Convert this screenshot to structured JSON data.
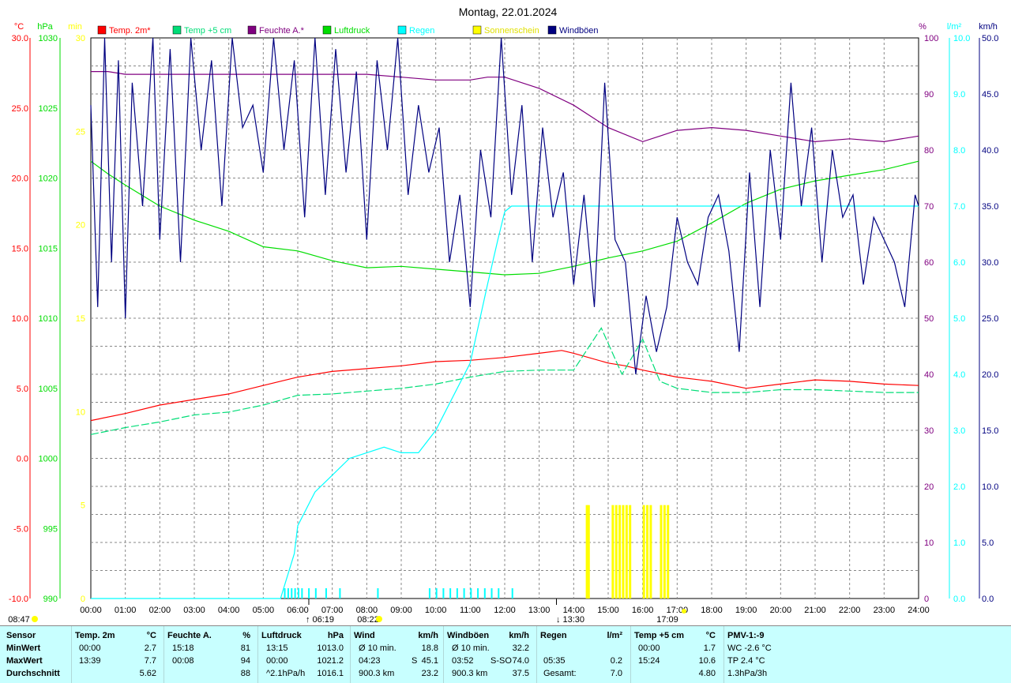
{
  "title": "Montag, 22.01.2024",
  "colors": {
    "temp2m": "#ff0000",
    "temp5cm": "#00dd77",
    "feuchte": "#800080",
    "luftdruck": "#00dd00",
    "regen": "#00ffff",
    "sonne": "#ffff00",
    "wind": "#000080",
    "grid": "#888888",
    "stats_bg": "#c8ffff"
  },
  "axis_units": {
    "temp": "°C",
    "hpa": "hPa",
    "min": "min",
    "pct": "%",
    "rain": "l/m²",
    "wind": "km/h"
  },
  "legend": [
    {
      "label": "Temp. 2m*",
      "color": "#ff0000"
    },
    {
      "label": "Temp +5 cm",
      "color": "#00dd77"
    },
    {
      "label": "Feuchte A.*",
      "color": "#800080"
    },
    {
      "label": "Luftdruck",
      "color": "#00dd00"
    },
    {
      "label": "Regen",
      "color": "#00ffff"
    },
    {
      "label": "Sonnenschein",
      "color": "#ffff00"
    },
    {
      "label": "Windböen",
      "color": "#000080"
    }
  ],
  "ticks": {
    "temp": [
      "30.0",
      "25.0",
      "20.0",
      "15.0",
      "10.0",
      "5.0",
      "0.0",
      "-5.0",
      "-10.0"
    ],
    "hpa": [
      "1030",
      "1025",
      "1020",
      "1015",
      "1010",
      "1005",
      "1000",
      "995",
      "990"
    ],
    "min": [
      "30",
      "25",
      "20",
      "15",
      "10",
      "5",
      "0"
    ],
    "pct": [
      "100",
      "90",
      "80",
      "70",
      "60",
      "50",
      "40",
      "30",
      "20",
      "10",
      "0"
    ],
    "rain": [
      "10.0",
      "9.0",
      "8.0",
      "7.0",
      "6.0",
      "5.0",
      "4.0",
      "3.0",
      "2.0",
      "1.0",
      "0.0"
    ],
    "wind": [
      "50.0",
      "45.0",
      "40.0",
      "35.0",
      "30.0",
      "25.0",
      "20.0",
      "15.0",
      "10.0",
      "5.0",
      "0.0"
    ],
    "hours": [
      "00:00",
      "01:00",
      "02:00",
      "03:00",
      "04:00",
      "05:00",
      "06:00",
      "07:00",
      "08:00",
      "09:00",
      "10:00",
      "11:00",
      "12:00",
      "13:00",
      "14:00",
      "15:00",
      "16:00",
      "17:00",
      "18:00",
      "19:00",
      "20:00",
      "21:00",
      "22:00",
      "23:00",
      "24:00"
    ]
  },
  "markers": [
    {
      "time": "08:47",
      "label": "08:47"
    },
    {
      "time": "06:19",
      "label": "↑ 06:19"
    },
    {
      "time": "08:22",
      "label": "08:22"
    },
    {
      "time": "13:30",
      "label": "↓ 13:30"
    },
    {
      "time": "17:09",
      "label": "17:09"
    }
  ],
  "chart_data": {
    "type": "line",
    "title": "Montag, 22.01.2024",
    "x_range": [
      "00:00",
      "24:00"
    ],
    "ylim_temp": [
      -10,
      30
    ],
    "ylim_hpa": [
      990,
      1030
    ],
    "ylim_min": [
      0,
      30
    ],
    "ylim_pct": [
      0,
      100
    ],
    "ylim_rain": [
      0,
      10
    ],
    "ylim_wind": [
      0,
      50
    ],
    "series": [
      {
        "name": "Temp. 2m*",
        "axis": "temp",
        "hours": [
          0,
          1,
          2,
          3,
          4,
          5,
          6,
          7,
          8,
          9,
          10,
          11,
          12,
          13,
          13.65,
          14,
          15,
          15.5,
          16,
          17,
          18,
          19,
          20,
          21,
          22,
          23,
          24
        ],
        "values": [
          2.7,
          3.2,
          3.8,
          4.2,
          4.6,
          5.2,
          5.8,
          6.2,
          6.4,
          6.6,
          6.9,
          7.0,
          7.2,
          7.5,
          7.7,
          7.5,
          6.8,
          6.6,
          6.3,
          5.8,
          5.5,
          5.0,
          5.3,
          5.6,
          5.5,
          5.3,
          5.2
        ]
      },
      {
        "name": "Temp +5 cm",
        "axis": "temp",
        "hours": [
          0,
          1,
          2,
          3,
          4,
          5,
          6,
          7,
          8,
          9,
          10,
          11,
          12,
          13,
          14,
          14.8,
          15.4,
          16,
          16.5,
          17,
          18,
          19,
          20,
          21,
          22,
          23,
          24
        ],
        "values": [
          1.7,
          2.2,
          2.6,
          3.1,
          3.3,
          3.8,
          4.5,
          4.6,
          4.8,
          5.0,
          5.3,
          5.8,
          6.2,
          6.3,
          6.3,
          9.3,
          6.0,
          8.5,
          5.5,
          5.0,
          4.7,
          4.7,
          4.9,
          4.9,
          4.8,
          4.7,
          4.7
        ]
      },
      {
        "name": "Feuchte A.*",
        "axis": "pct",
        "hours": [
          0,
          0.5,
          1,
          2,
          3,
          4,
          5,
          6,
          7,
          8,
          9,
          10,
          11,
          11.5,
          12,
          13,
          14,
          15,
          16,
          16.5,
          17,
          18,
          19,
          20,
          21,
          22,
          23,
          24
        ],
        "values": [
          94,
          94,
          93.5,
          93.5,
          93.5,
          93.5,
          93.5,
          93.5,
          93.5,
          93.5,
          93,
          92.5,
          92.5,
          93,
          93,
          91,
          88,
          84,
          81.5,
          82.5,
          83.5,
          84,
          83.5,
          82.5,
          81.5,
          82,
          81.5,
          82.5
        ]
      },
      {
        "name": "Luftdruck",
        "axis": "hpa",
        "hours": [
          0,
          0.5,
          1,
          2,
          3,
          4,
          5,
          6,
          7,
          8,
          9,
          10,
          11,
          12,
          13,
          14,
          15,
          16,
          17,
          18,
          19,
          20,
          21,
          22,
          23,
          24
        ],
        "values": [
          1021.2,
          1020.3,
          1019.5,
          1018,
          1017,
          1016.2,
          1015.1,
          1014.8,
          1014.1,
          1013.6,
          1013.7,
          1013.5,
          1013.3,
          1013.1,
          1013.2,
          1013.7,
          1014.3,
          1014.8,
          1015.5,
          1016.8,
          1018.2,
          1019.2,
          1019.8,
          1020.2,
          1020.6,
          1021.2
        ]
      },
      {
        "name": "Regen",
        "axis": "rain",
        "hours": [
          0,
          5.5,
          5.6,
          5.9,
          6,
          6.5,
          7,
          7.5,
          8,
          8.5,
          9,
          9.5,
          10,
          10.5,
          11,
          11.5,
          11.8,
          12,
          12.2,
          12.7,
          13,
          13.5,
          14,
          14.5,
          15,
          16,
          17,
          18,
          19,
          20,
          21,
          22,
          23,
          24
        ],
        "values": [
          0,
          0,
          0.2,
          0.8,
          1.3,
          1.9,
          2.2,
          2.5,
          2.6,
          2.7,
          2.6,
          2.6,
          3.0,
          3.6,
          4.2,
          5.6,
          6.4,
          6.9,
          7.0,
          7.0,
          7.0,
          7.0,
          7.0,
          7.0,
          7.0,
          7.0,
          7.0,
          7.0,
          7.0,
          7.0,
          7.0,
          7.0,
          7.0,
          7.0
        ]
      },
      {
        "name": "Windböen",
        "axis": "wind",
        "hours": [
          0,
          0.2,
          0.4,
          0.6,
          0.8,
          1,
          1.2,
          1.5,
          1.8,
          2,
          2.3,
          2.6,
          2.9,
          3.2,
          3.5,
          3.8,
          4.1,
          4.4,
          4.7,
          5,
          5.3,
          5.6,
          5.9,
          6.2,
          6.5,
          6.8,
          7.1,
          7.4,
          7.7,
          8,
          8.3,
          8.6,
          8.9,
          9.2,
          9.5,
          9.8,
          10.1,
          10.4,
          10.7,
          11,
          11.3,
          11.6,
          11.9,
          12.2,
          12.5,
          12.8,
          13.1,
          13.4,
          13.7,
          14,
          14.3,
          14.6,
          14.9,
          15.2,
          15.5,
          15.8,
          16.1,
          16.4,
          16.7,
          17,
          17.3,
          17.6,
          17.9,
          18.2,
          18.5,
          18.8,
          19.1,
          19.4,
          19.7,
          20,
          20.3,
          20.6,
          20.9,
          21.2,
          21.5,
          21.8,
          22.1,
          22.4,
          22.7,
          23,
          23.3,
          23.6,
          23.9,
          24
        ],
        "values": [
          44,
          26,
          50,
          30,
          48,
          25,
          46,
          35,
          50,
          32,
          49,
          30,
          50,
          40,
          48,
          35,
          50,
          42,
          44,
          38,
          50,
          40,
          48,
          34,
          50,
          36,
          49,
          38,
          47,
          32,
          48,
          40,
          50,
          36,
          44,
          38,
          42,
          30,
          36,
          26,
          40,
          34,
          50,
          36,
          44,
          30,
          42,
          34,
          38,
          28,
          36,
          26,
          46,
          32,
          30,
          20,
          27,
          22,
          26,
          34,
          30,
          28,
          34,
          36,
          31,
          22,
          38,
          26,
          40,
          32,
          46,
          35,
          42,
          30,
          40,
          34,
          36,
          28,
          34,
          32,
          30,
          26,
          36,
          35
        ]
      }
    ],
    "sun_minutes": {
      "hours": [
        14.35,
        14.4,
        15.1,
        15.2,
        15.3,
        15.4,
        15.5,
        15.6,
        16.0,
        16.1,
        16.2,
        16.5,
        16.6,
        16.7
      ],
      "values": [
        2,
        2,
        2,
        2,
        2,
        2,
        2,
        2,
        2,
        2,
        2,
        2,
        2,
        2
      ]
    },
    "rain_blips_hours": [
      5.6,
      5.7,
      5.8,
      5.9,
      6.0,
      6.1,
      6.3,
      6.5,
      6.8,
      7.2,
      8.3,
      9.8,
      10.0,
      10.2,
      10.4,
      10.6,
      10.8,
      11.0,
      11.2,
      11.4,
      11.6,
      11.8,
      12.2
    ]
  },
  "stats": {
    "headers": [
      "Sensor",
      "Temp. 2m",
      "°C",
      "Feuchte A.",
      "%",
      "Luftdruck",
      "hPa",
      "Wind",
      "km/h",
      "Windböen",
      "km/h",
      "Regen",
      "l/m²",
      "Temp +5 cm",
      "°C",
      "PMV-1:-9"
    ],
    "min": {
      "label": "MinWert",
      "temp_t": "00:00",
      "temp_v": "2.7",
      "hum_t": "15:18",
      "hum_v": "81",
      "pres_t": "13:15",
      "pres_v": "1013.0",
      "wind_t": "Ø 10 min.",
      "wind_v": "18.8",
      "gust_t": "Ø 10 min.",
      "gust_v": "32.2",
      "t5_t": "00:00",
      "t5_v": "1.7",
      "pmv": "WC -2.6 °C"
    },
    "max": {
      "label": "MaxWert",
      "temp_t": "13:39",
      "temp_v": "7.7",
      "hum_t": "00:08",
      "hum_v": "94",
      "pres_t": "00:00",
      "pres_v": "1021.2",
      "wind_t": "04:23",
      "wind_dir": "S",
      "wind_v": "45.1",
      "gust_t": "03:52",
      "gust_dir": "S-SO",
      "gust_v": "74.0",
      "rain_t": "05:35",
      "rain_v": "0.2",
      "t5_t": "15:24",
      "t5_v": "10.6",
      "pmv": "TP 2.4 °C"
    },
    "avg": {
      "label": "Durchschnitt",
      "temp_v": "5.62",
      "hum_v": "88",
      "pres_t": "^2.1hPa/h",
      "pres_v": "1016.1",
      "wind_t": "900.3 km",
      "wind_v": "23.2",
      "gust_t": "900.3 km",
      "gust_v": "37.5",
      "rain_t": "Gesamt:",
      "rain_v": "7.0",
      "t5_v": "4.80",
      "pmv": "1.3hPa/3h"
    }
  }
}
